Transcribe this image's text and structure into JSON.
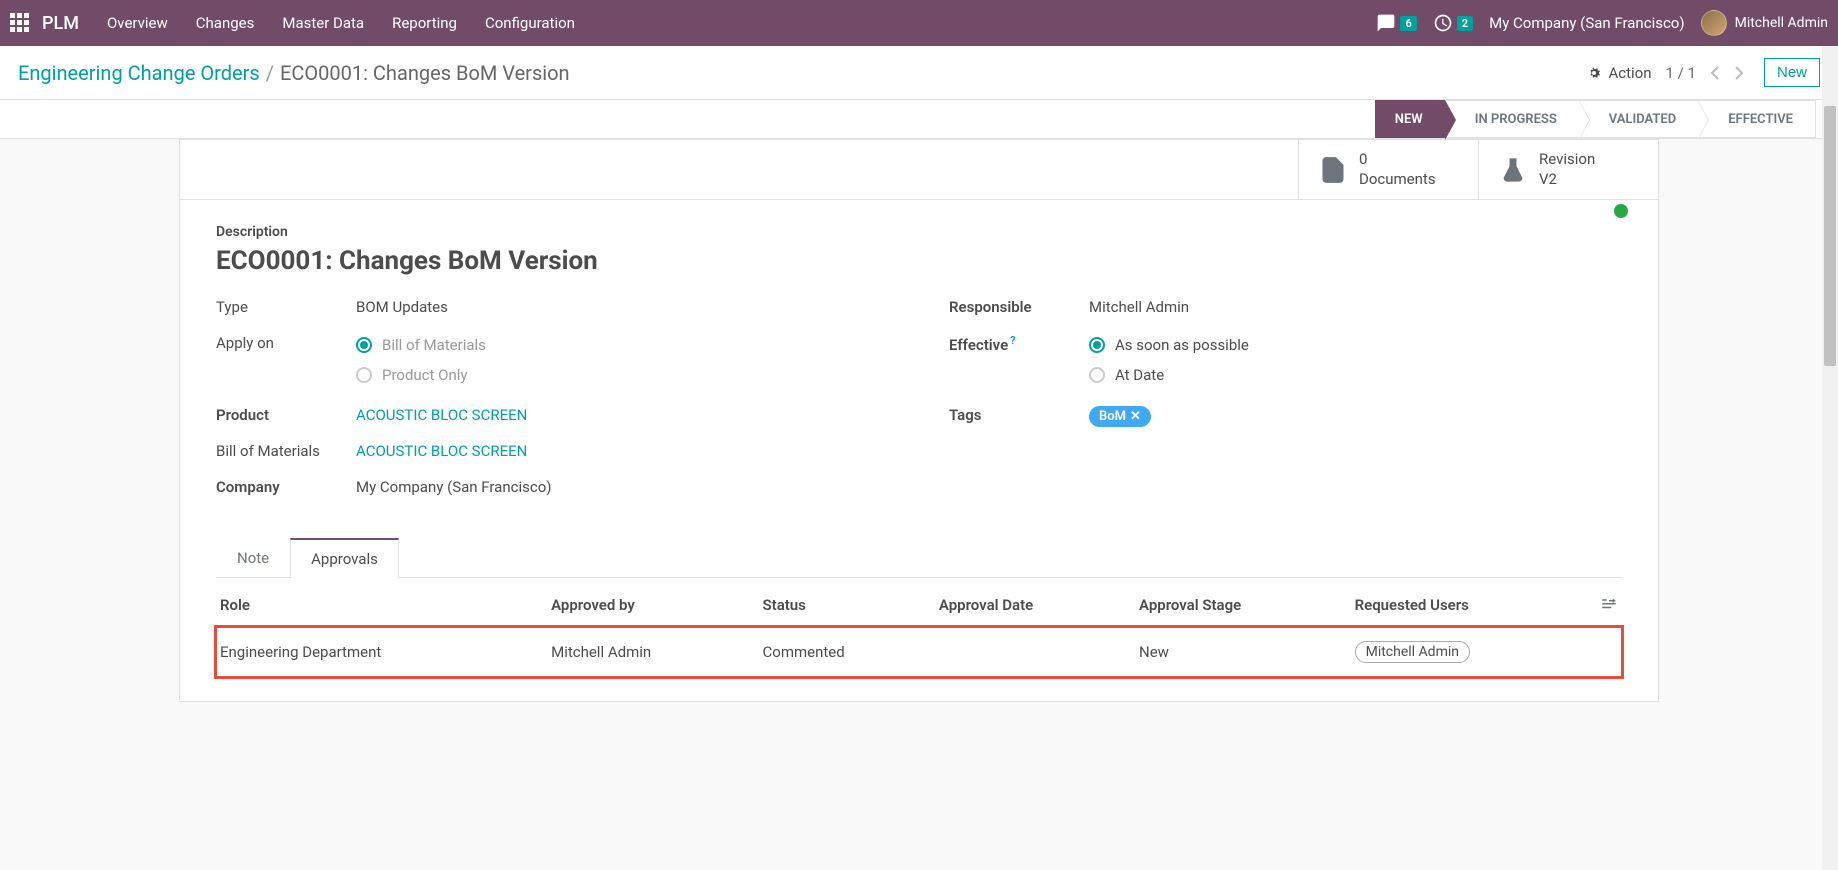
{
  "topbar": {
    "app_name": "PLM",
    "menu": [
      "Overview",
      "Changes",
      "Master Data",
      "Reporting",
      "Configuration"
    ],
    "msg_count": "6",
    "activity_count": "2",
    "company": "My Company (San Francisco)",
    "user": "Mitchell Admin"
  },
  "breadcrumb": {
    "parent": "Engineering Change Orders",
    "current": "ECO0001: Changes BoM Version"
  },
  "cp": {
    "action_label": "Action",
    "pager": "1 / 1",
    "new_label": "New"
  },
  "status": {
    "steps": [
      "NEW",
      "IN PROGRESS",
      "VALIDATED",
      "EFFECTIVE"
    ]
  },
  "stats": {
    "doc_count": "0",
    "doc_label": "Documents",
    "rev_label": "Revision",
    "rev_value": "V2"
  },
  "form": {
    "desc_label": "Description",
    "title": "ECO0001: Changes  BoM Version",
    "type_label": "Type",
    "type_value": "BOM Updates",
    "apply_label": "Apply on",
    "apply_bom": "Bill of Materials",
    "apply_product": "Product Only",
    "product_label": "Product",
    "product_value": "ACOUSTIC BLOC SCREEN",
    "bom_label": "Bill of Materials",
    "bom_value": "ACOUSTIC BLOC SCREEN",
    "company_label": "Company",
    "company_value": "My Company (San Francisco)",
    "responsible_label": "Responsible",
    "responsible_value": "Mitchell Admin",
    "effective_label": "Effective",
    "effective_asap": "As soon as possible",
    "effective_atdate": "At Date",
    "tags_label": "Tags",
    "tag_value": "BoM"
  },
  "tabs": {
    "note": "Note",
    "approvals": "Approvals"
  },
  "approvals": {
    "headers": {
      "role": "Role",
      "approved_by": "Approved by",
      "status": "Status",
      "date": "Approval Date",
      "stage": "Approval Stage",
      "requested": "Requested Users"
    },
    "row": {
      "role": "Engineering Department",
      "approved_by": "Mitchell Admin",
      "status": "Commented",
      "date": "",
      "stage": "New",
      "requested": "Mitchell Admin"
    }
  }
}
